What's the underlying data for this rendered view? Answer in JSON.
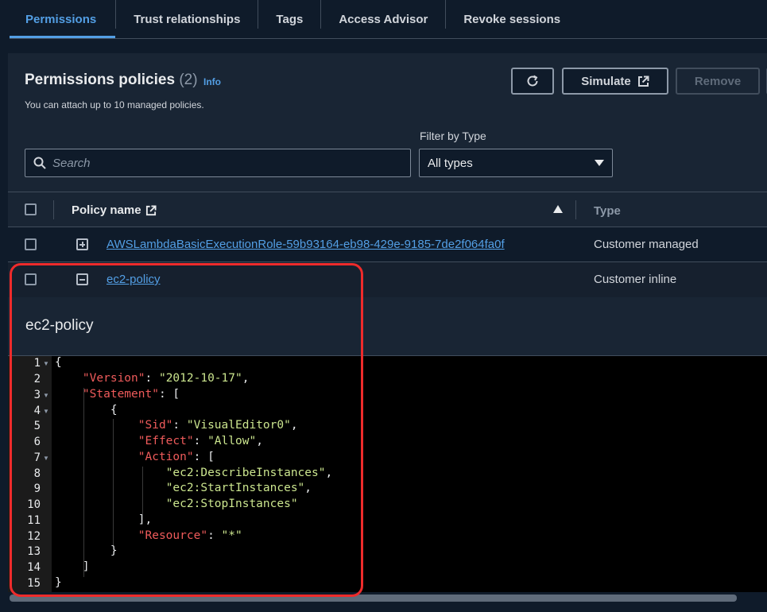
{
  "tabs": [
    {
      "label": "Permissions",
      "active": true
    },
    {
      "label": "Trust relationships"
    },
    {
      "label": "Tags"
    },
    {
      "label": "Access Advisor"
    },
    {
      "label": "Revoke sessions"
    }
  ],
  "panel": {
    "title": "Permissions policies",
    "count": "(2)",
    "info": "Info",
    "description": "You can attach up to 10 managed policies.",
    "buttons": {
      "simulate": "Simulate",
      "remove": "Remove"
    },
    "filter_label": "Filter by Type",
    "search_placeholder": "Search",
    "filter_value": "All types"
  },
  "table": {
    "columns": {
      "name": "Policy name",
      "type": "Type"
    },
    "rows": [
      {
        "name": "AWSLambdaBasicExecutionRole-59b93164-eb98-429e-9185-7de2f064fa0f",
        "type": "Customer managed",
        "expanded": false
      },
      {
        "name": "ec2-policy",
        "type": "Customer inline",
        "expanded": true
      }
    ]
  },
  "detail": {
    "title": "ec2-policy",
    "line_numbers": [
      "1",
      "2",
      "3",
      "4",
      "5",
      "6",
      "7",
      "8",
      "9",
      "10",
      "11",
      "12",
      "13",
      "14",
      "15"
    ]
  },
  "colors": {
    "accent": "#539fe5",
    "highlight": "#ee2b2b",
    "json_key": "#ef5b5b",
    "json_string": "#cbe58e"
  }
}
